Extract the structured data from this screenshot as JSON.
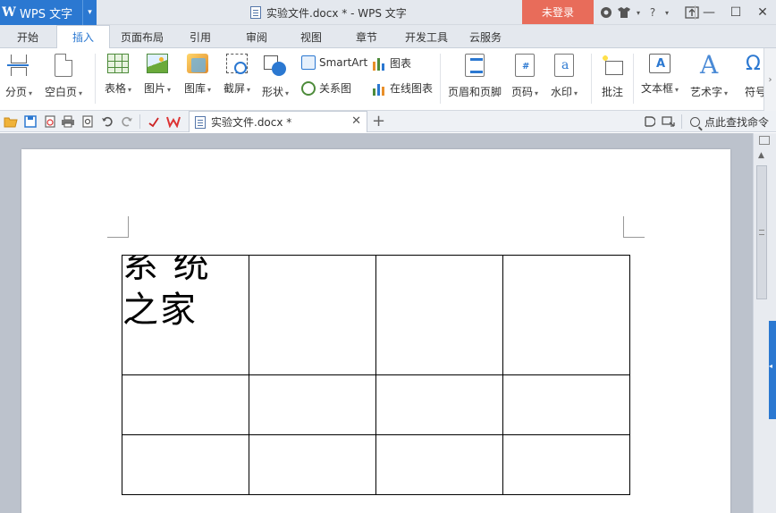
{
  "titlebar": {
    "app_logo": "W",
    "app_name": "WPS 文字",
    "app_menu_arrow": "▾",
    "doc_title": "实验文件.docx * - WPS 文字",
    "login_label": "未登录",
    "help_label": "?",
    "window_controls": {
      "minimize": "—",
      "maximize": "☐",
      "close": "✕"
    }
  },
  "menu": {
    "tabs": [
      "开始",
      "插入",
      "页面布局",
      "引用",
      "审阅",
      "视图",
      "章节",
      "开发工具",
      "云服务"
    ],
    "active": "插入"
  },
  "ribbon": {
    "page_break": "分页",
    "blank_page": "空白页",
    "table": "表格",
    "picture": "图片",
    "gallery": "图库",
    "screenshot": "截屏",
    "shape": "形状",
    "smartart": "SmartArt",
    "relation_chart": "关系图",
    "chart": "图表",
    "online_chart": "在线图表",
    "header_footer": "页眉和页脚",
    "page_number": "页码",
    "watermark": "水印",
    "comment": "批注",
    "text_box": "文本框",
    "word_art": "艺术字",
    "symbol": "符号",
    "dropdown_arrow": "▾",
    "scroll_arrow": "›"
  },
  "quickbar": {
    "doc_tab": "实验文件.docx *",
    "tab_close": "✕",
    "new_tab": "+",
    "search_command": "点此查找命令"
  },
  "document": {
    "table_cell_text": "系 统\n之家"
  },
  "colors": {
    "accent": "#2b78d1",
    "login_bg": "#e86c5a",
    "workspace_bg": "#bcc2cc"
  }
}
